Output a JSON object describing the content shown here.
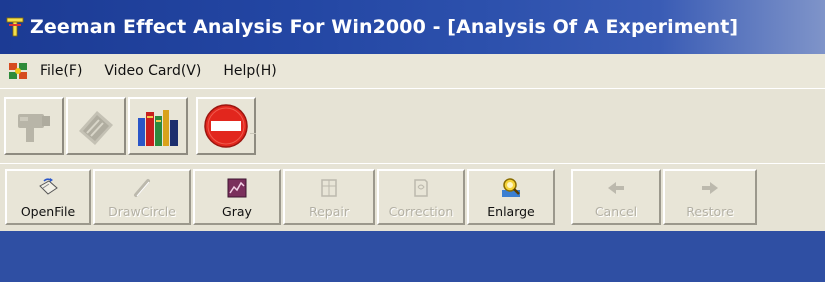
{
  "window": {
    "title": "Zeeman Effect Analysis For Win2000 - [Analysis  Of  A   Experiment]",
    "icon": "app-icon"
  },
  "menu": {
    "items": [
      {
        "label": "File(F)",
        "name": "menu-file"
      },
      {
        "label": "Video Card(V)",
        "name": "menu-video-card"
      },
      {
        "label": "Help(H)",
        "name": "menu-help"
      }
    ]
  },
  "toolbar_big": {
    "buttons": [
      {
        "name": "camera-button",
        "icon": "camera-icon",
        "enabled": false
      },
      {
        "name": "video-card-button",
        "icon": "card-icon",
        "enabled": false
      },
      {
        "name": "books-button",
        "icon": "books-icon",
        "enabled": true
      },
      {
        "name": "stop-button",
        "icon": "stop-icon",
        "enabled": true
      }
    ]
  },
  "toolbar_small": {
    "buttons": [
      {
        "name": "open-file-button",
        "label": "OpenFile",
        "icon": "open-file-icon",
        "enabled": true
      },
      {
        "name": "draw-circle-button",
        "label": "DrawCircle",
        "icon": "pencil-icon",
        "enabled": false
      },
      {
        "name": "gray-button",
        "label": "Gray",
        "icon": "gray-icon",
        "enabled": true
      },
      {
        "name": "repair-button",
        "label": "Repair",
        "icon": "repair-icon",
        "enabled": false
      },
      {
        "name": "correction-button",
        "label": "Correction",
        "icon": "correction-icon",
        "enabled": false
      },
      {
        "name": "enlarge-button",
        "label": "Enlarge",
        "icon": "magnifier-icon",
        "enabled": true
      },
      {
        "name": "cancel-button",
        "label": "Cancel",
        "icon": "arrow-left-icon",
        "enabled": false
      },
      {
        "name": "restore-button",
        "label": "Restore",
        "icon": "arrow-right-icon",
        "enabled": false
      }
    ]
  },
  "colors": {
    "titlebar": "#2346a3",
    "workspace": "#2f4fa3",
    "face": "#e8e5d7"
  }
}
